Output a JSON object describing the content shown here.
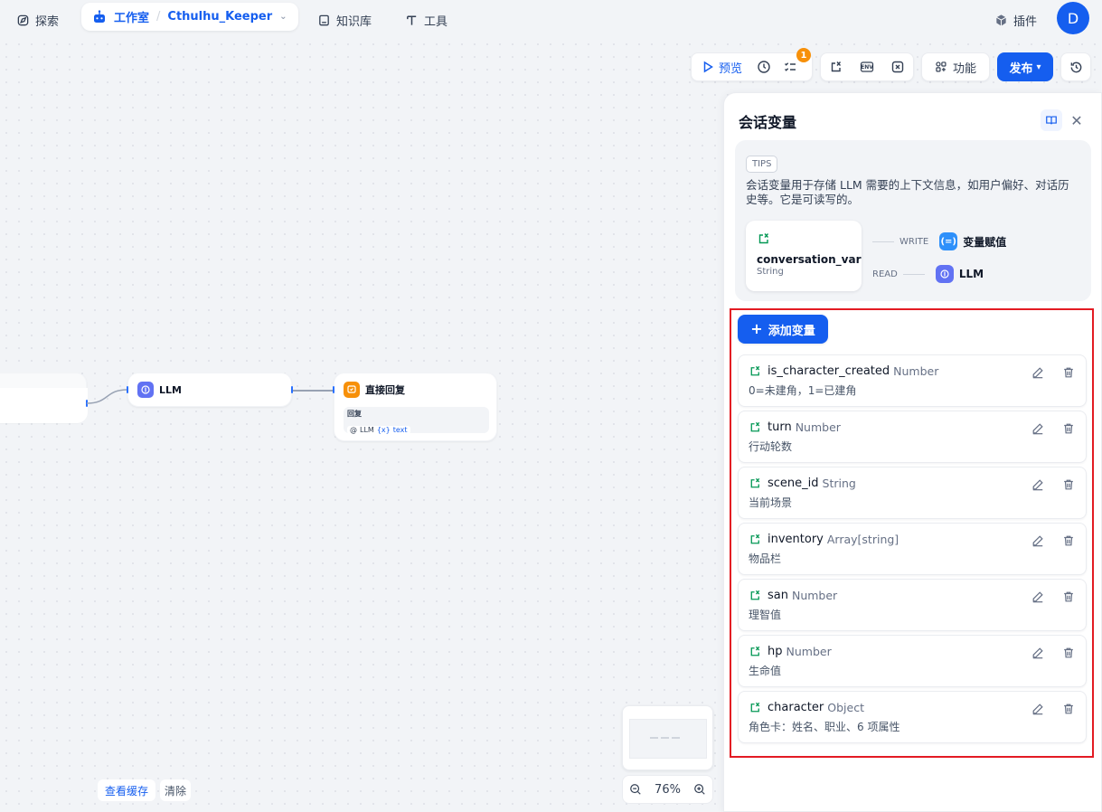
{
  "nav": {
    "explore": "探索",
    "studio": "工作室",
    "app_name": "Cthulhu_Keeper",
    "knowledge": "知识库",
    "tools": "工具",
    "plugins": "插件",
    "avatar_letter": "D"
  },
  "toolbar": {
    "preview": "预览",
    "checklist_badge": "1",
    "env_label": "ENV",
    "features": "功能",
    "publish": "发布"
  },
  "canvas": {
    "llm_node_title": "LLM",
    "answer_node_title": "直接回复",
    "answer_field_label": "回复",
    "answer_ref_node": "LLM",
    "answer_ref_var": "text",
    "view_cache": "查看缓存",
    "clear": "清除",
    "zoom_level": "76%"
  },
  "panel": {
    "title": "会话变量",
    "tips_tag": "TIPS",
    "tips_text": "会话变量用于存储 LLM 需要的上下文信息，如用户偏好、对话历史等。它是可读写的。",
    "example_var_name": "conversation_var",
    "example_var_type": "String",
    "write_label": "WRITE",
    "write_target": "变量赋值",
    "read_label": "READ",
    "read_target": "LLM",
    "add_button": "添加变量",
    "variables": [
      {
        "name": "is_character_created",
        "type": "Number",
        "desc": "0=未建角，1=已建角"
      },
      {
        "name": "turn",
        "type": "Number",
        "desc": "行动轮数"
      },
      {
        "name": "scene_id",
        "type": "String",
        "desc": "当前场景"
      },
      {
        "name": "inventory",
        "type": "Array[string]",
        "desc": "物品栏"
      },
      {
        "name": "san",
        "type": "Number",
        "desc": "理智值"
      },
      {
        "name": "hp",
        "type": "Number",
        "desc": "生命值"
      },
      {
        "name": "character",
        "type": "Object",
        "desc": "角色卡：姓名、职业、6 项属性"
      }
    ]
  },
  "colors": {
    "accent": "#155eef",
    "variable_icon": "#039855",
    "highlight_frame": "#e31b23",
    "answer_node": "#f79009",
    "llm_node": "#6172f3"
  }
}
